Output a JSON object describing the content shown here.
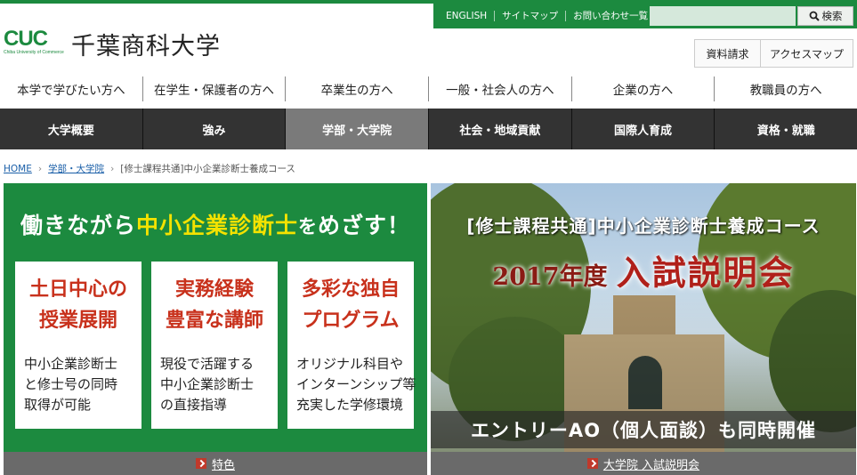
{
  "header": {
    "logo_text": "CUC",
    "logo_sub": "Chiba University of Commerce",
    "university_name": "千葉商科大学"
  },
  "util_nav": [
    {
      "label": "ENGLISH"
    },
    {
      "label": "サイトマップ"
    },
    {
      "label": "お問い合わせ一覧"
    }
  ],
  "search": {
    "placeholder": "",
    "button_label": "検索"
  },
  "side_buttons": {
    "brochure": "資料請求",
    "access": "アクセスマップ"
  },
  "audience_nav": [
    {
      "label": "本学で学びたい方へ"
    },
    {
      "label": "在学生・保護者の方へ"
    },
    {
      "label": "卒業生の方へ"
    },
    {
      "label": "一般・社会人の方へ"
    },
    {
      "label": "企業の方へ"
    },
    {
      "label": "教職員の方へ"
    }
  ],
  "main_nav": [
    {
      "label": "大学概要",
      "active": false
    },
    {
      "label": "強み",
      "active": false
    },
    {
      "label": "学部・大学院",
      "active": true
    },
    {
      "label": "社会・地域貢献",
      "active": false
    },
    {
      "label": "国際人育成",
      "active": false
    },
    {
      "label": "資格・就職",
      "active": false
    }
  ],
  "breadcrumb": {
    "home": "HOME",
    "parent": "学部・大学院",
    "current": "[修士課程共通]中小企業診断士養成コース"
  },
  "feature_banner": {
    "headline_pre": "働きながら",
    "headline_highlight": "中小企業診断士",
    "headline_small": "を",
    "headline_post": "めざす！",
    "cards": [
      {
        "title": "土日中心の\n授業展開",
        "body": "中小企業診断士\nと修士号の同時\n取得が可能"
      },
      {
        "title": "実務経験\n豊富な講師",
        "body": "現役で活躍する\n中小企業診断士\nの直接指導"
      },
      {
        "title": "多彩な独自\nプログラム",
        "body": "オリジナル科目や\nインターンシップ等\n充実した学修環境"
      }
    ],
    "footer_link": "特色"
  },
  "event_banner": {
    "title": "[修士課程共通]中小企業診断士養成コース",
    "year": "2017年度",
    "event": "入試説明会",
    "footer_text": "エントリーAO（個人面談）も同時開催",
    "footer_link": "大学院 入試説明会"
  },
  "colors": {
    "brand_green": "#1c8a3f",
    "highlight_yellow": "#f4e200",
    "accent_red": "#c8311c",
    "nav_dark": "#333333",
    "nav_active": "#7a7a7a"
  },
  "icons": [
    "search-icon",
    "chevron-right-icon"
  ]
}
